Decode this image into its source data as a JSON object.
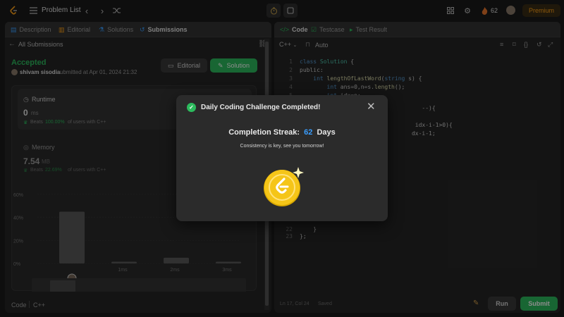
{
  "topbar": {
    "problem_list": "Problem List",
    "streak_count": "62",
    "premium": "Premium"
  },
  "left_panel": {
    "tabs": [
      "Description",
      "Editorial",
      "Solutions",
      "Submissions"
    ],
    "all_submissions": "All Submissions",
    "status": "Accepted",
    "user": "shivam sisodia",
    "submitted_text": "submitted at Apr 01, 2024 21:32",
    "editorial_button": "Editorial",
    "solution_button": "Solution",
    "runtime": {
      "title": "Runtime",
      "value": "0",
      "unit": "ms",
      "beats_label": "Beats",
      "beats_value": "100.00%",
      "beats_suffix": "of users with C++"
    },
    "memory": {
      "title": "Memory",
      "value": "7.54",
      "unit": "MB",
      "beats_label": "Beats",
      "beats_value": "22.69%",
      "beats_suffix": "of users with C++"
    },
    "footer_code": "Code",
    "footer_lang": "C++"
  },
  "chart_data": {
    "type": "bar",
    "categories": [
      "0ms",
      "1ms",
      "2ms",
      "3ms"
    ],
    "values": [
      45,
      1.5,
      5,
      1.5
    ],
    "ylim": [
      0,
      60
    ],
    "y_ticks": [
      "60%",
      "40%",
      "20%",
      "0%"
    ],
    "x_tick_labels": [
      "1ms",
      "2ms",
      "3ms"
    ],
    "mini_labels": [
      "1ms",
      "2ms",
      "3ms"
    ],
    "title": "",
    "xlabel": "",
    "ylabel": ""
  },
  "right_panel": {
    "tabs": [
      "Code",
      "Testcase",
      "Test Result"
    ],
    "language": "C++",
    "auto": "Auto",
    "code_lines": [
      {
        "n": "1",
        "t": "class Solution {"
      },
      {
        "n": "2",
        "t": "public:"
      },
      {
        "n": "3",
        "t": "    int lengthOfLastWord(string s) {"
      },
      {
        "n": "4",
        "t": "        int ans=0,n=s.length();"
      },
      {
        "n": "5",
        "t": "        int idx=n;"
      },
      {
        "n": "6",
        "t": "                                    --){"
      },
      {
        "n": "7",
        "t": "                                  idx-i-1>0){"
      },
      {
        "n": "8",
        "t": "                                 dx-i-1;"
      },
      {
        "n": "22",
        "t": "    }"
      },
      {
        "n": "23",
        "t": "};"
      }
    ],
    "status_bar": "Ln 17, Col 24",
    "saved": "Saved",
    "run": "Run",
    "submit": "Submit"
  },
  "modal": {
    "title": "Daily Coding Challenge Completed!",
    "streak_label": "Completion Streak:",
    "streak_value": "62",
    "streak_unit": "Days",
    "message": "Consistency is key, see you tomorrow!"
  },
  "colors": {
    "accepted": "#2cbb5d",
    "streak_blue": "#3a9eff",
    "coin": "#f5c518",
    "submit": "#2cbb5d"
  }
}
